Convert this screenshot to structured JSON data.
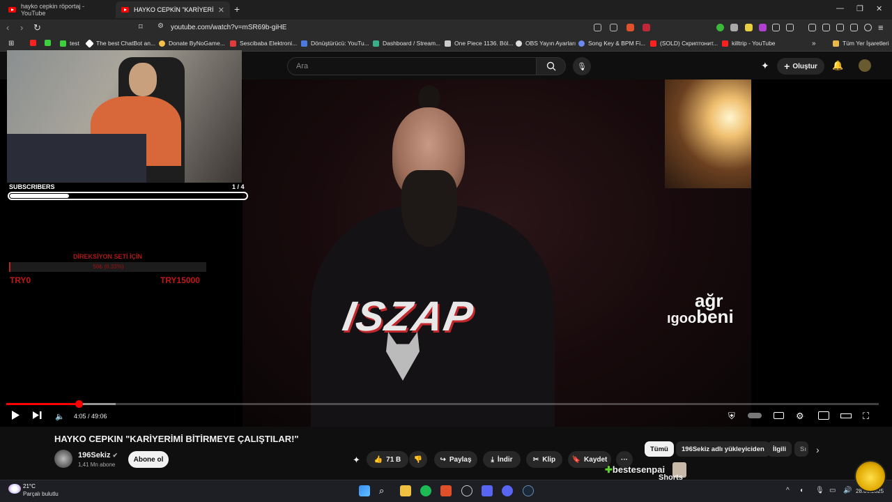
{
  "tabs": [
    {
      "label": "hayko cepkin röportaj - YouTube"
    },
    {
      "label": "HAYKO CEPKİN \"KARİYERİMİ BİT"
    }
  ],
  "address": {
    "url": "youtube.com/watch?v=mSR69b-giHE"
  },
  "bookmarks": [
    {
      "label": "test",
      "color": "#3ecf3e"
    },
    {
      "label": "The best ChatBot an...",
      "color": "#ffffff"
    },
    {
      "label": "Donate ByNoGame...",
      "color": "#f5c04a"
    },
    {
      "label": "Sescibaba Elektroni...",
      "color": "#e03a3a"
    },
    {
      "label": "Dönüştürücü: YouTu...",
      "color": "#4a7ae0"
    },
    {
      "label": "Dashboard / Stream...",
      "color": "#3ab08a"
    },
    {
      "label": "One Piece 1136. Böl...",
      "color": "#cccccc"
    },
    {
      "label": "OBS Yayın Ayarları",
      "color": "#dddddd"
    },
    {
      "label": "Song Key & BPM Fi...",
      "color": "#6a8af0"
    },
    {
      "label": "(SOLD) Скриптонит...",
      "color": "#ff2020"
    },
    {
      "label": "killtrip - YouTube",
      "color": "#ff2020"
    }
  ],
  "bookmarks_all": "Tüm Yer İşaretleri",
  "youtube": {
    "search_placeholder": "Ara",
    "create_label": "Oluştur"
  },
  "overlay": {
    "subscribers_label": "SUBSCRIBERS",
    "subscribers_count": "1 / 4",
    "subscribers_progress": 0.25,
    "goal_title": "DİREKSİYON SETİ İÇİN",
    "goal_value": "50₺ (0.33%)",
    "goal_min": "TRY0",
    "goal_max": "TRY15000"
  },
  "watermark": {
    "line1": "ağr",
    "line2": "beni",
    "prefix": "ıgoo"
  },
  "player": {
    "timecode": "4:05 / 49:06",
    "played_fraction": 0.083,
    "buffered_fraction": 0.125
  },
  "video": {
    "title": "HAYKO CEPKIN \"KARİYERİMİ BİTİRMEYE ÇALIŞTILAR!\"",
    "channel": "196Sekiz",
    "channel_subs": "1,41 Mn abone",
    "subscribe_label": "Abone ol",
    "likes": "71 B",
    "share_label": "Paylaş",
    "download_label": "İndir",
    "clip_label": "Klip",
    "save_label": "Kaydet",
    "more_label": "···"
  },
  "chips": [
    {
      "label": "Tümü",
      "active": true
    },
    {
      "label": "196Sekiz adlı yükleyiciden",
      "active": false
    },
    {
      "label": "İlgili",
      "active": false
    },
    {
      "label": "Sı",
      "active": false
    }
  ],
  "stream_overlay": {
    "name": "bestesenpai",
    "shorts": "Shorts"
  },
  "taskbar": {
    "weather_temp": "21°C",
    "weather_desc": "Parçalı bulutlu",
    "clock": "28.06.2025"
  },
  "colors": {
    "accent": "#ff0000",
    "goal_red": "#c01818"
  }
}
